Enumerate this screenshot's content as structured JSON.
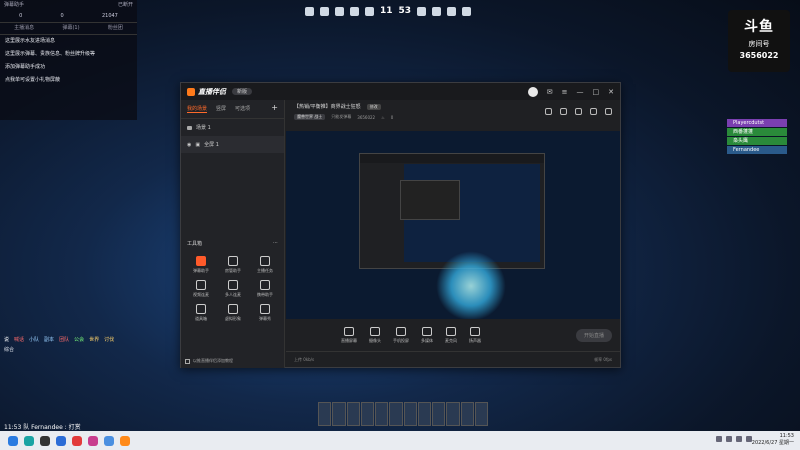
{
  "game_hud": {
    "clock_h": "11",
    "clock_m": "53"
  },
  "danmaku": {
    "title": "弹幕助手",
    "status": "已断开",
    "stats": [
      "0",
      "0",
      "21047"
    ],
    "tabs": [
      "主播消息",
      "弹幕(1)",
      "粉丝团"
    ],
    "messages": [
      "这里展示水友进场消息",
      "这里展示弹幕、贵族信息、粉丝牌升级等",
      "添加弹幕助手成功",
      "点我单可设置小礼物屏蔽"
    ]
  },
  "chat": {
    "channels": [
      "说",
      "喊话",
      "小队",
      "副本",
      "团队",
      "公会",
      "世界",
      "讨伐"
    ],
    "last_line": "11:53 队 Fernandee : 打赏",
    "input_label": "综合"
  },
  "douyu_logo": {
    "brand": "斗鱼",
    "room_label": "房间号",
    "room_id": "3656022"
  },
  "party": {
    "members": [
      "Playercdutst",
      "西番蓬蓬",
      "枭头鹰",
      "Fernandee"
    ]
  },
  "streamer_app": {
    "app_name": "直播伴侣",
    "version": "新版",
    "scene_tabs": [
      "我的场景",
      "竖屏",
      "可选项"
    ],
    "scenes": [
      "场景 1",
      "全屏 1"
    ],
    "tools_title": "工具箱",
    "tools": [
      "弹幕助手",
      "房管助手",
      "主播任务",
      "视频连麦",
      "多人连麦",
      "携带助手",
      "道具箱",
      "虚拟形象",
      "弹幕秀"
    ],
    "footer_toggle": "以推直播伴侣添加教程",
    "room_title": "【热销/平衡推】商界战士狂怒",
    "room_badge": "修改",
    "category": "魔兽世界 战士",
    "room_prefix": "只能发弹幕",
    "room_id": "3656022",
    "heat": "0",
    "controls": [
      "直播屏幕",
      "摄像头",
      "手机投屏",
      "多媒体",
      "麦克风",
      "扬声器"
    ],
    "start_button": "开始直播",
    "status_left": "上传 0kb/s",
    "status_right": "帧率 0fps"
  },
  "taskbar": {
    "time": "11:53",
    "date": "2022/6/27 星期一"
  },
  "colors": {
    "accent": "#ff6a2a",
    "window_bg": "#1f2023",
    "taskbar": "#e9ecf1"
  }
}
